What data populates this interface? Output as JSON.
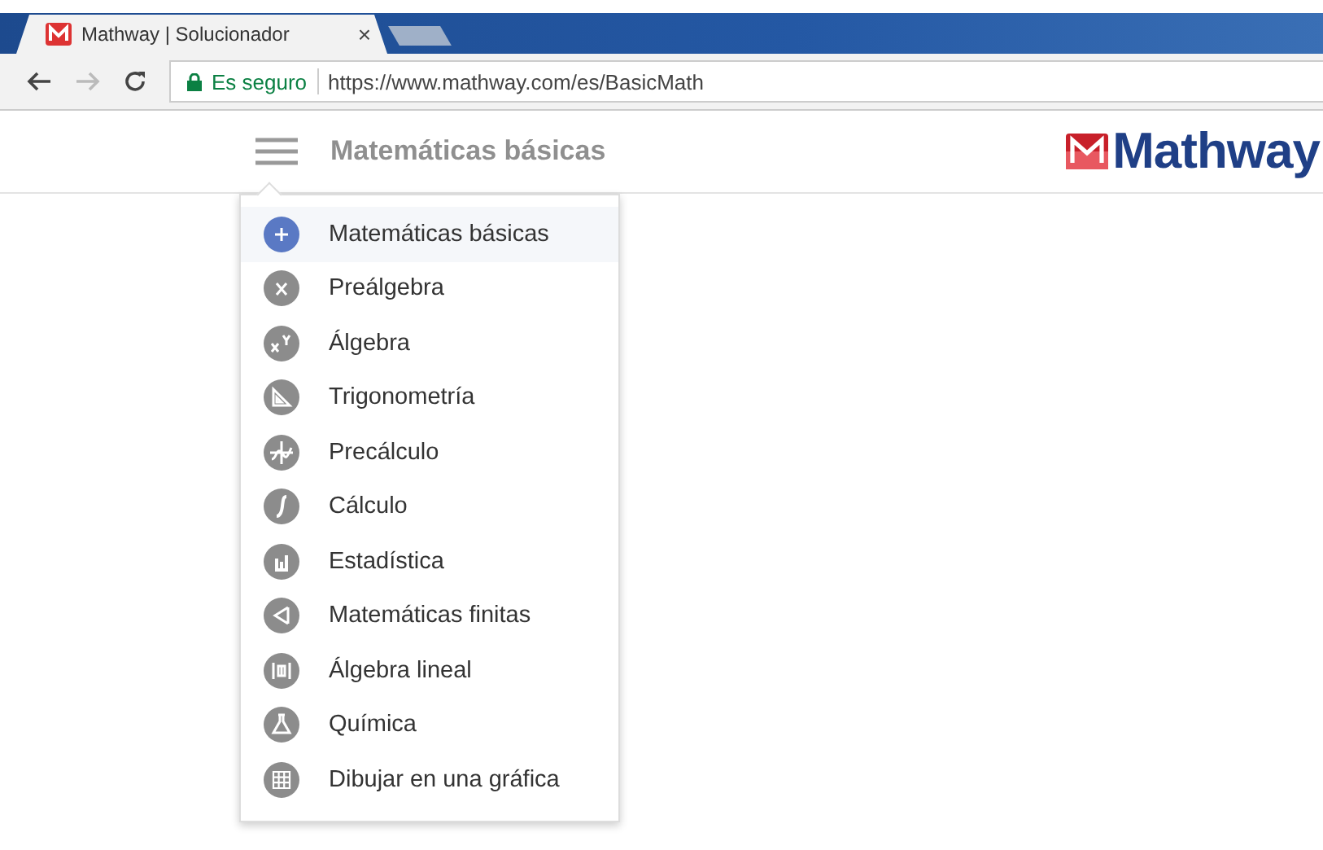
{
  "browser": {
    "tab_title": "Mathway | Solucionador",
    "tab_close": "×",
    "security": "Es seguro",
    "url": "https://www.mathway.com/es/BasicMath"
  },
  "header": {
    "subject": "Matemáticas básicas",
    "logo": "Mathway"
  },
  "menu": [
    {
      "label": "Matemáticas básicas",
      "selected": true
    },
    {
      "label": "Preálgebra",
      "selected": false
    },
    {
      "label": "Álgebra",
      "selected": false
    },
    {
      "label": "Trigonometría",
      "selected": false
    },
    {
      "label": "Precálculo",
      "selected": false
    },
    {
      "label": "Cálculo",
      "selected": false
    },
    {
      "label": "Estadística",
      "selected": false
    },
    {
      "label": "Matemáticas finitas",
      "selected": false
    },
    {
      "label": "Álgebra lineal",
      "selected": false
    },
    {
      "label": "Química",
      "selected": false
    },
    {
      "label": "Dibujar en una gráfica",
      "selected": false
    }
  ]
}
